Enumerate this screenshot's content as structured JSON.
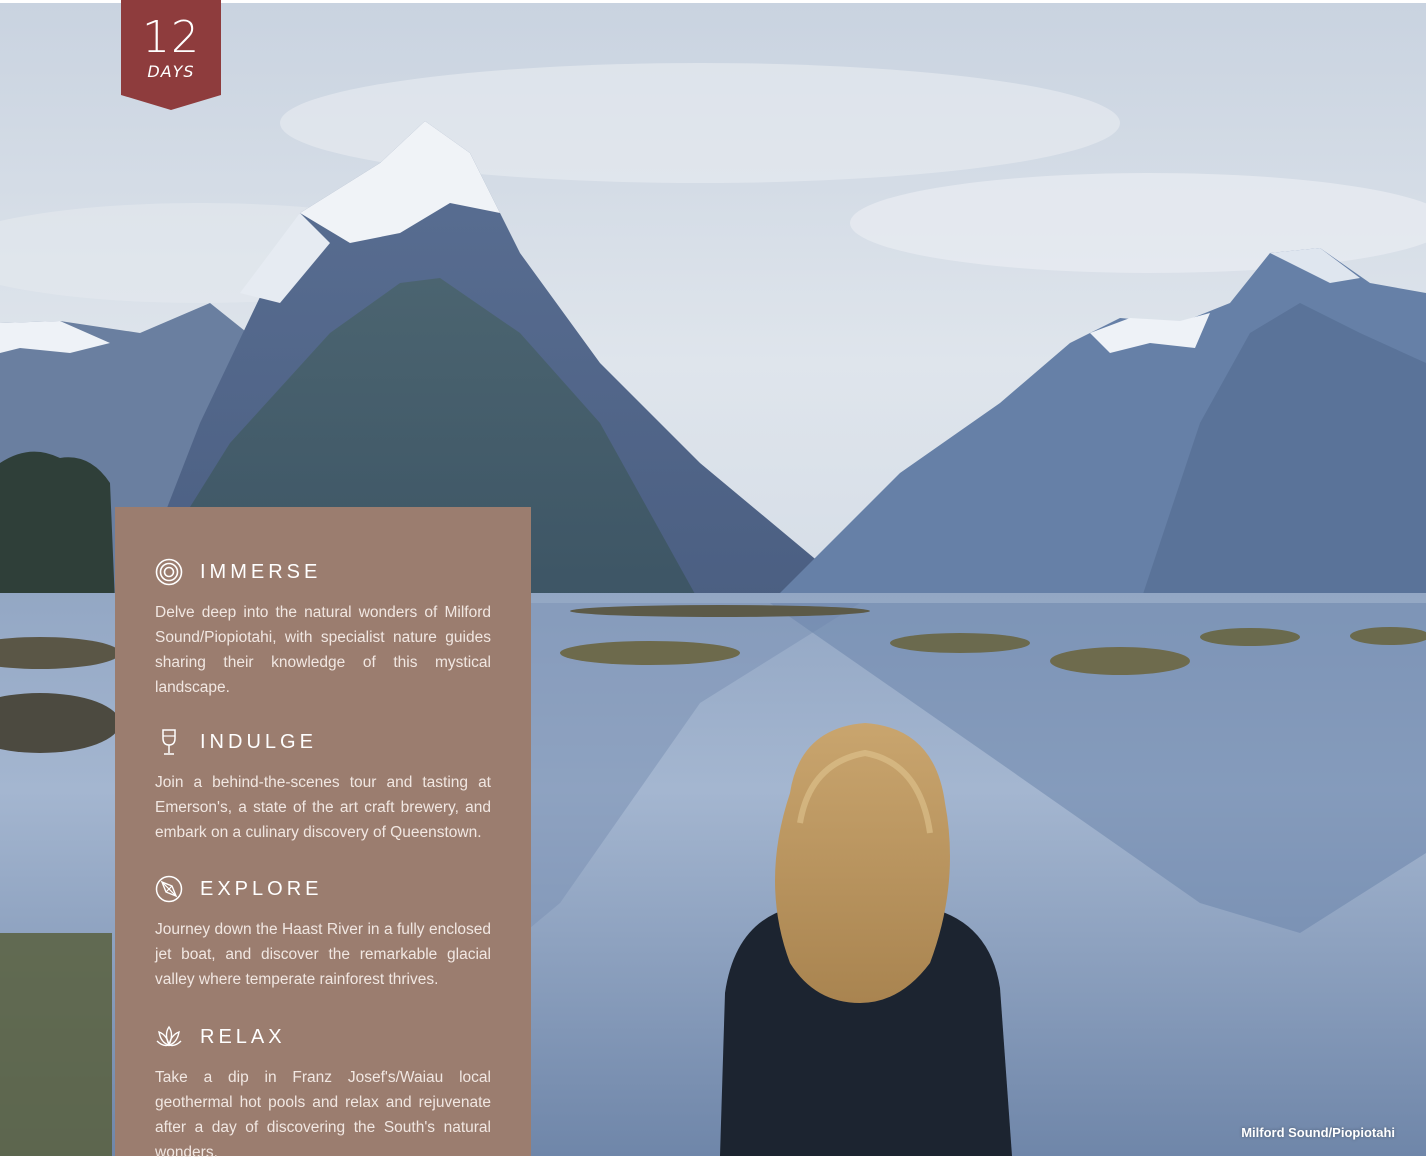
{
  "badge": {
    "number": "12",
    "unit": "DAYS",
    "color": "#8e3c3d"
  },
  "panel": {
    "color": "#9b7d6f",
    "sections": [
      {
        "icon": "target-rings-icon",
        "title": "IMMERSE",
        "text": "Delve deep into the natural wonders of Milford Sound/Piopiotahi, with specialist nature guides sharing their knowledge of this mystical landscape."
      },
      {
        "icon": "wine-glass-icon",
        "title": "INDULGE",
        "text": "Join a behind-the-scenes tour and tasting at Emerson's, a state of the art craft brewery, and embark on a culinary discovery of Queenstown."
      },
      {
        "icon": "compass-icon",
        "title": "EXPLORE",
        "text": "Journey down the Haast River in a fully enclosed jet boat, and discover the remarkable glacial valley where temperate rainforest thrives."
      },
      {
        "icon": "lotus-icon",
        "title": "RELAX",
        "text": "Take a dip in Franz Josef's/Waiau local geothermal hot pools and relax and rejuvenate after a day of discovering the South's natural wonders."
      }
    ]
  },
  "photo": {
    "caption": "Milford Sound/Piopiotahi"
  }
}
